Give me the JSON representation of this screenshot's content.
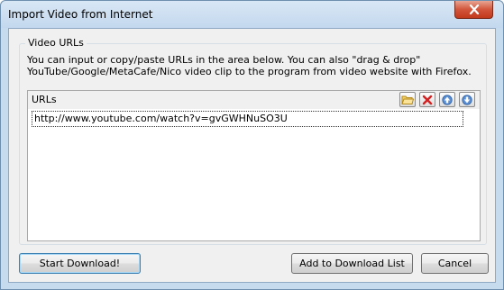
{
  "window": {
    "title": "Import Video from Internet"
  },
  "group": {
    "legend": "Video URLs",
    "description_line1": "You can input or copy/paste URLs in the area below. You can also \"drag & drop\"",
    "description_line2": "YouTube/Google/MetaCafe/Nico video clip to the program from video website with Firefox."
  },
  "url_panel": {
    "header_label": "URLs",
    "urls": [
      "http://www.youtube.com/watch?v=gvGWHNuSO3U"
    ],
    "toolbar_icons": [
      "folder-open-icon",
      "delete-icon",
      "move-up-icon",
      "move-down-icon"
    ]
  },
  "buttons": {
    "start_download": "Start Download!",
    "add_to_list": "Add to Download List",
    "cancel": "Cancel"
  },
  "colors": {
    "title_bar": "#c3d8ee",
    "close_button": "#c7432a",
    "dialog_background": "#f0f0f0",
    "default_button_border": "#3c7fb1"
  }
}
